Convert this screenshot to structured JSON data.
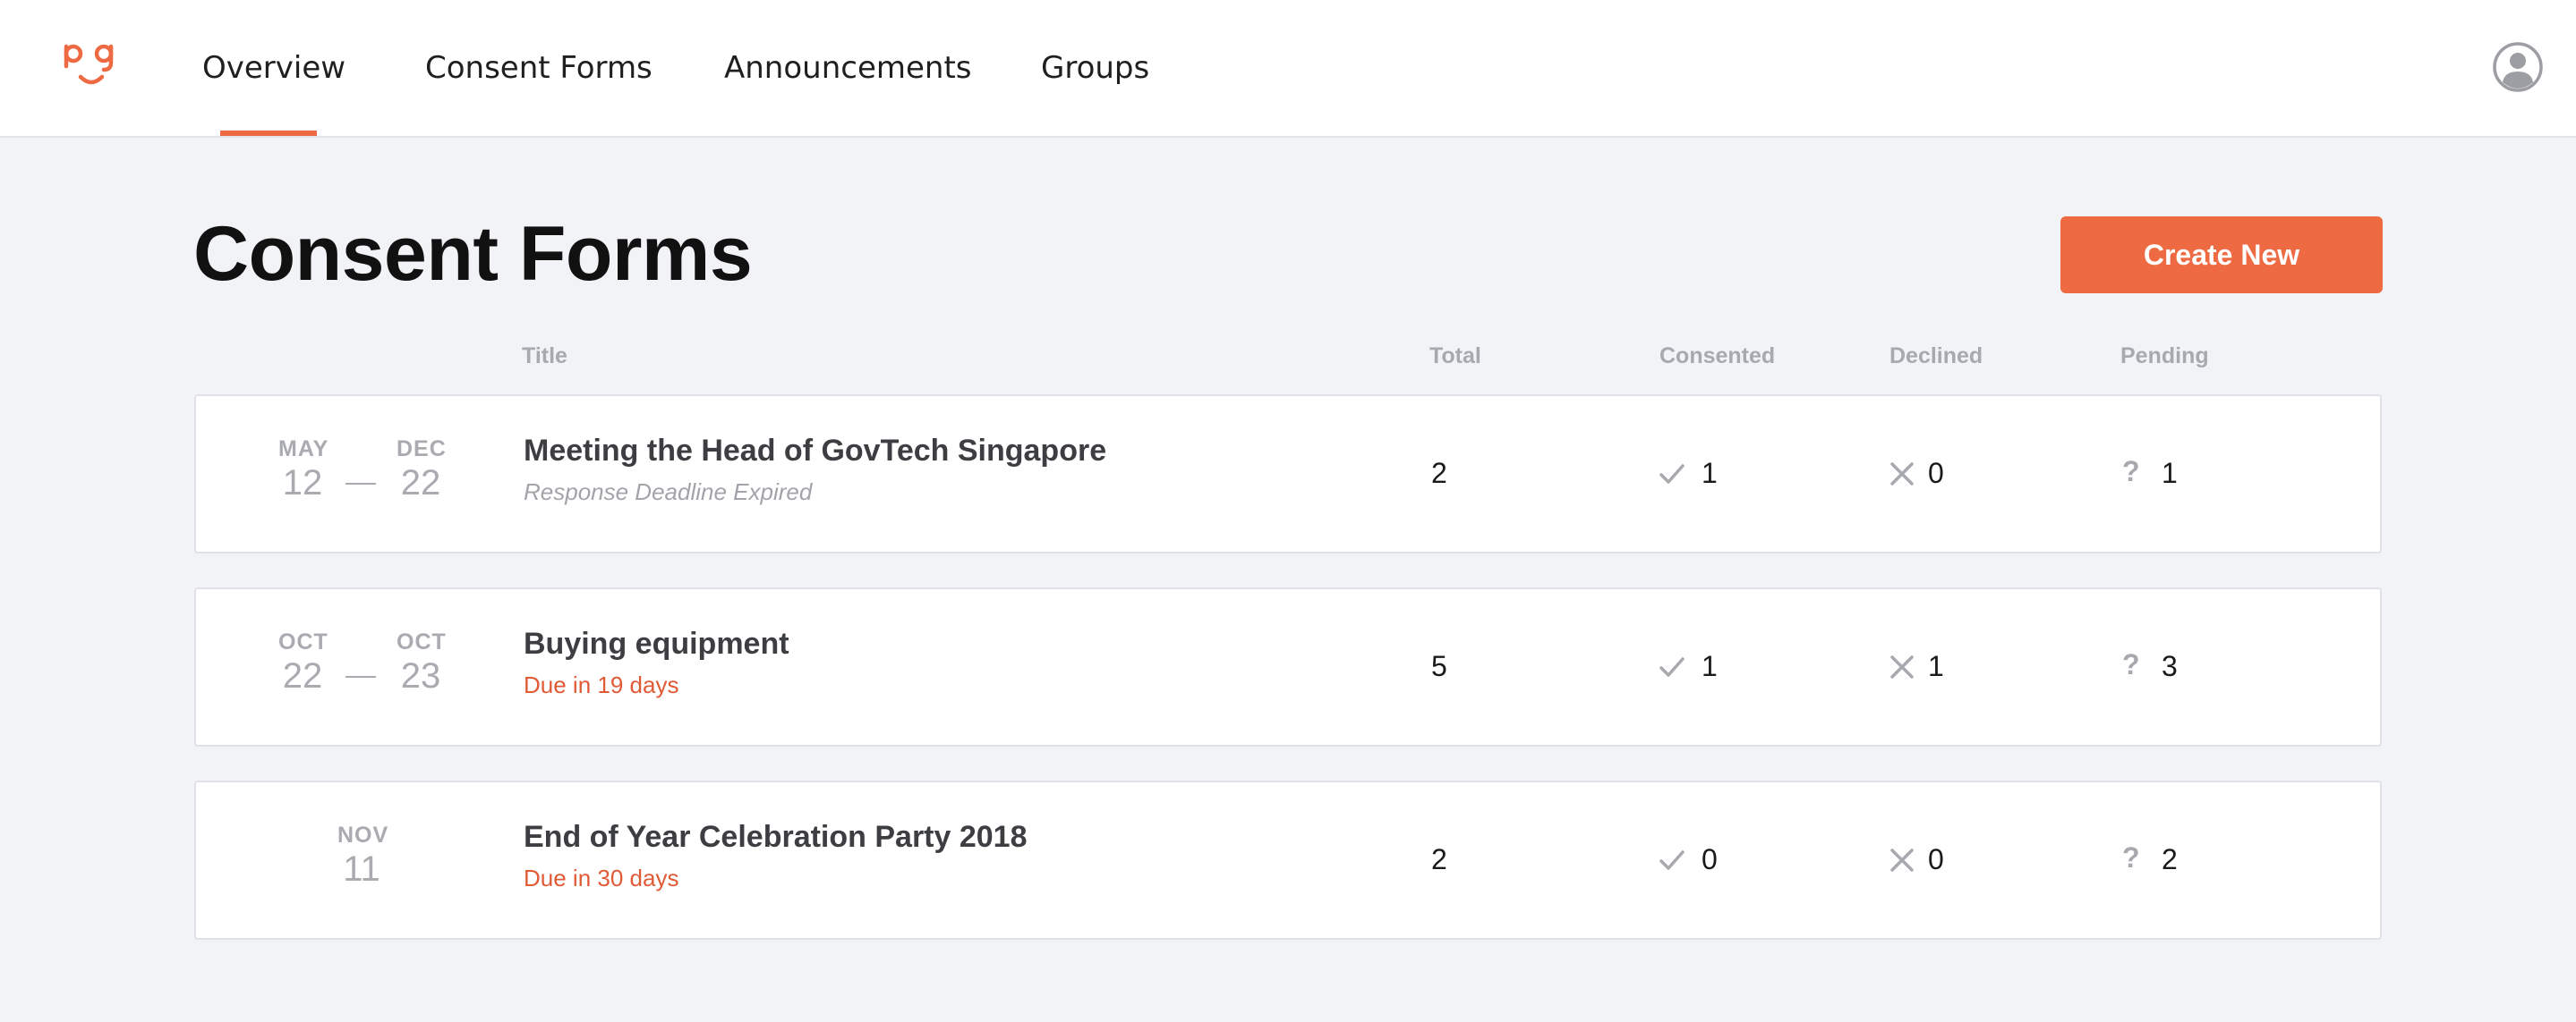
{
  "nav": {
    "items": [
      {
        "label": "Overview",
        "active": true
      },
      {
        "label": "Consent Forms",
        "active": false
      },
      {
        "label": "Announcements",
        "active": false
      },
      {
        "label": "Groups",
        "active": false
      }
    ],
    "user_icon": "user-circle-icon",
    "logo_icon": "pg-smiley-logo"
  },
  "page": {
    "title": "Consent Forms",
    "create_label": "Create New"
  },
  "table": {
    "headers": {
      "title": "Title",
      "total": "Total",
      "consented": "Consented",
      "declined": "Declined",
      "pending": "Pending"
    },
    "rows": [
      {
        "start_month": "MAY",
        "start_day": "12",
        "end_month": "DEC",
        "end_day": "22",
        "title": "Meeting the Head of GovTech Singapore",
        "subtitle": "Response Deadline Expired",
        "status": "expired",
        "total": "2",
        "consented": "1",
        "declined": "0",
        "pending": "1"
      },
      {
        "start_month": "OCT",
        "start_day": "22",
        "end_month": "OCT",
        "end_day": "23",
        "title": "Buying equipment",
        "subtitle": "Due in 19 days",
        "status": "due",
        "total": "5",
        "consented": "1",
        "declined": "1",
        "pending": "3"
      },
      {
        "start_month": "NOV",
        "start_day": "11",
        "end_month": "",
        "end_day": "",
        "title": "End of Year Celebration Party 2018",
        "subtitle": "Due in 30 days",
        "status": "due",
        "total": "2",
        "consented": "0",
        "declined": "0",
        "pending": "2"
      }
    ]
  },
  "colors": {
    "accent": "#ee6a43",
    "due_text": "#e05a35",
    "muted": "#a7a9ae",
    "background": "#f2f3f7"
  }
}
